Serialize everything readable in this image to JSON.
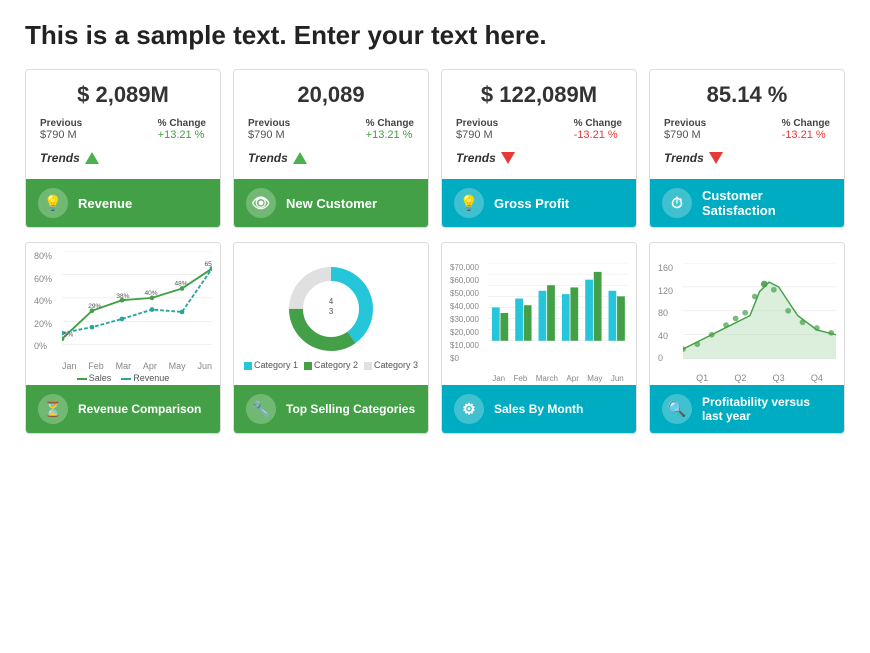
{
  "page": {
    "title": "This is a sample text. Enter your text here."
  },
  "kpi_cards": [
    {
      "id": "revenue",
      "value": "$ 2,089M",
      "previous_label": "Previous",
      "previous_val": "$790 M",
      "change_label": "% Change",
      "change_val": "+13.21 %",
      "trend": "up",
      "footer_label": "Revenue",
      "footer_icon": "💡",
      "footer_color": "green"
    },
    {
      "id": "new-customer",
      "value": "20,089",
      "previous_label": "Previous",
      "previous_val": "$790 M",
      "change_label": "% Change",
      "change_val": "+13.21 %",
      "trend": "up",
      "footer_label": "New Customer",
      "footer_icon": "👁",
      "footer_color": "green"
    },
    {
      "id": "gross-profit",
      "value": "$ 122,089M",
      "previous_label": "Previous",
      "previous_val": "$790 M",
      "change_label": "% Change",
      "change_val": "-13.21 %",
      "trend": "down",
      "footer_label": "Gross Profit",
      "footer_icon": "💡",
      "footer_color": "teal"
    },
    {
      "id": "customer-satisfaction",
      "value": "85.14 %",
      "previous_label": "Previous",
      "previous_val": "$790 M",
      "change_label": "% Change",
      "change_val": "-13.21 %",
      "trend": "down",
      "footer_label": "Customer Satisfaction",
      "footer_icon": "⏱",
      "footer_color": "teal"
    }
  ],
  "chart_cards": [
    {
      "id": "revenue-comparison",
      "footer_label": "Revenue Comparison",
      "footer_icon": "⏳",
      "footer_color": "green"
    },
    {
      "id": "top-selling",
      "footer_label": "Top Selling Categories",
      "footer_icon": "🔧",
      "footer_color": "green"
    },
    {
      "id": "sales-by-month",
      "footer_label": "Sales By Month",
      "footer_icon": "⚙",
      "footer_color": "teal"
    },
    {
      "id": "profitability",
      "footer_label": "Profitability versus last year",
      "footer_icon": "🔍",
      "footer_color": "teal"
    }
  ],
  "line_chart": {
    "y_labels": [
      "80%",
      "60%",
      "40%",
      "20%",
      "0%"
    ],
    "x_labels": [
      "Jan",
      "Feb",
      "Mar",
      "Apr",
      "May",
      "Jun"
    ],
    "sales_data": [
      5,
      29,
      38,
      40,
      48,
      65
    ],
    "revenue_data": [
      10,
      15,
      22,
      30,
      28,
      65
    ],
    "legend": [
      "Sales",
      "Revenue"
    ]
  },
  "donut_chart": {
    "segments": [
      {
        "label": "Category 1",
        "value": 40,
        "color": "#26c6da"
      },
      {
        "label": "Category 2",
        "value": 35,
        "color": "#43a047"
      },
      {
        "label": "Category 3",
        "value": 25,
        "color": "#e0e0e0"
      }
    ]
  },
  "bar_chart": {
    "y_labels": [
      "$70,000",
      "$60,000",
      "$50,000",
      "$40,000",
      "$30,000",
      "$20,000",
      "$10,000",
      "$0"
    ],
    "x_labels": [
      "Jan",
      "Feb",
      "March",
      "Apr",
      "May",
      "Jun"
    ],
    "series1": [
      30,
      38,
      45,
      42,
      55,
      45
    ],
    "series2": [
      25,
      32,
      50,
      48,
      62,
      40
    ]
  },
  "scatter_chart": {
    "y_labels": [
      "160",
      "120",
      "80",
      "40",
      "0"
    ],
    "x_labels": [
      "Q1",
      "Q2",
      "Q3",
      "Q4"
    ]
  }
}
